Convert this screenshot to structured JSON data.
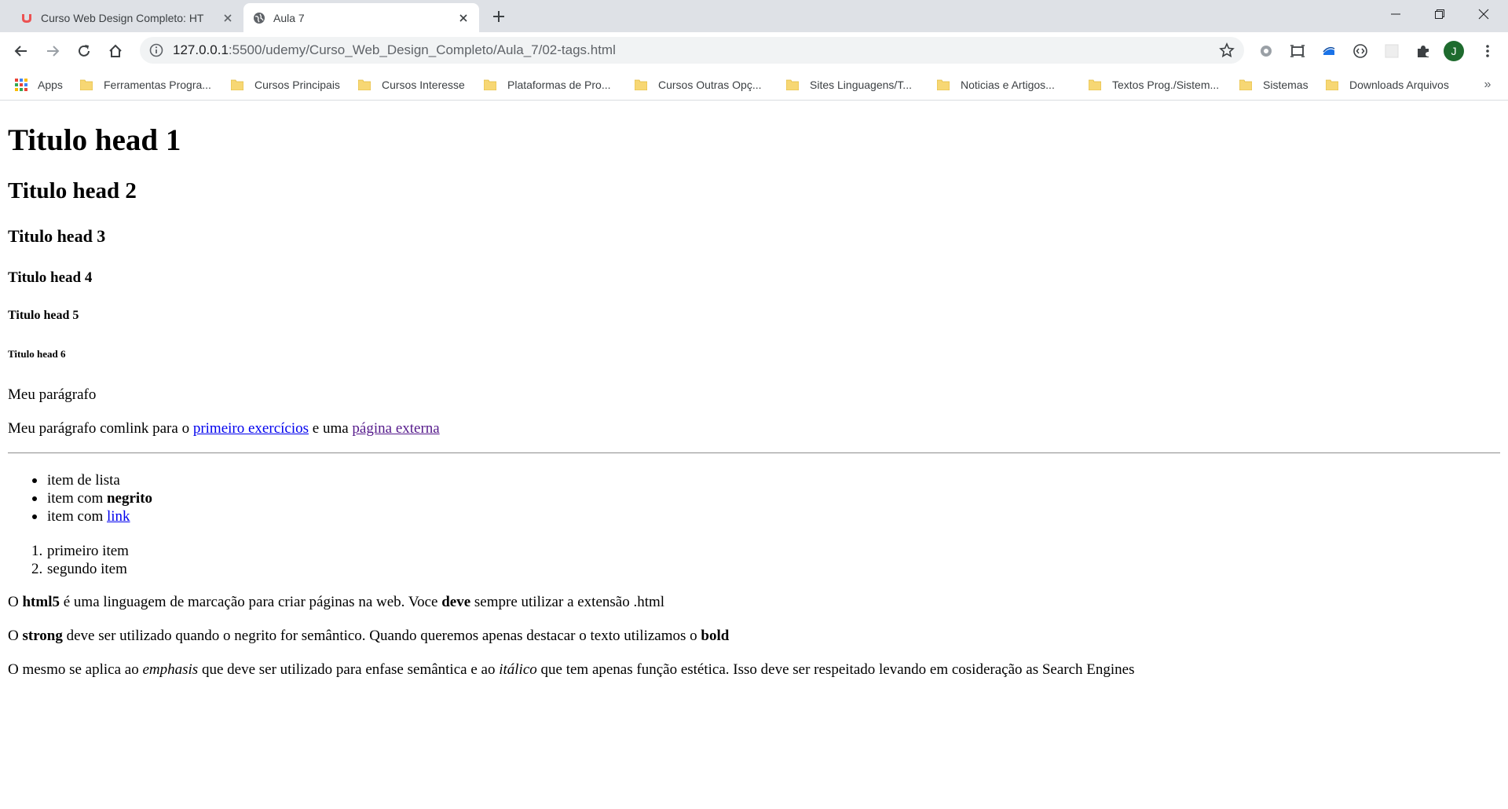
{
  "browser": {
    "tabs": [
      {
        "title": "Curso Web Design Completo: HT",
        "active": false
      },
      {
        "title": "Aula 7",
        "active": true
      }
    ],
    "address": {
      "host": "127.0.0.1",
      "path": ":5500/udemy/Curso_Web_Design_Completo/Aula_7/02-tags.html"
    },
    "avatar_letter": "J",
    "colors": {
      "tabstrip": "#dee1e6",
      "omnibox": "#f1f3f4",
      "folder": "#f7d774",
      "avatar": "#1e6b2e"
    }
  },
  "bookmarks": {
    "apps_label": "Apps",
    "items": [
      "Ferramentas Progra...",
      "Cursos Principais",
      "Cursos Interesse",
      "Plataformas de Pro...",
      "Cursos Outras Opç...",
      "Sites Linguagens/T...",
      "Noticias e Artigos...",
      "Textos Prog./Sistem...",
      "Sistemas",
      "Downloads Arquivos"
    ],
    "more": "»"
  },
  "page": {
    "h1": "Titulo head 1",
    "h2": "Titulo head 2",
    "h3": "Titulo head 3",
    "h4": "Titulo head 4",
    "h5": "Titulo head 5",
    "h6": "Titulo head 6",
    "p1": "Meu parágrafo",
    "p2": {
      "before": "Meu parágrafo comlink para o ",
      "link1": "primeiro exercícios",
      "middle": " e uma ",
      "link2": "página externa"
    },
    "ul": {
      "item1": "item de lista",
      "item2_text": "item com ",
      "item2_bold": "negrito",
      "item3_text": "item com ",
      "item3_link": "link"
    },
    "ol": {
      "n1": "1.",
      "item1": "primeiro item",
      "n2": "2.",
      "item2": "segundo item"
    },
    "p3": {
      "a": "O ",
      "b1": "html5",
      "c": " é uma linguagem de marcação para criar páginas na web. Voce ",
      "b2": "deve",
      "d": " sempre utilizar a extensão .html"
    },
    "p4": {
      "a": "O ",
      "b1": "strong",
      "c": " deve ser utilizado quando o negrito for semântico. Quando queremos apenas destacar o texto utilizamos o ",
      "b2": "bold"
    },
    "p5": {
      "a": "O mesmo se aplica ao ",
      "i1": "emphasis",
      "b": " que deve ser utilizado para enfase semântica e ao ",
      "i2": "itálico",
      "c": " que tem apenas função estética. Isso deve ser respeitado levando em cosideração as Search Engines"
    }
  }
}
